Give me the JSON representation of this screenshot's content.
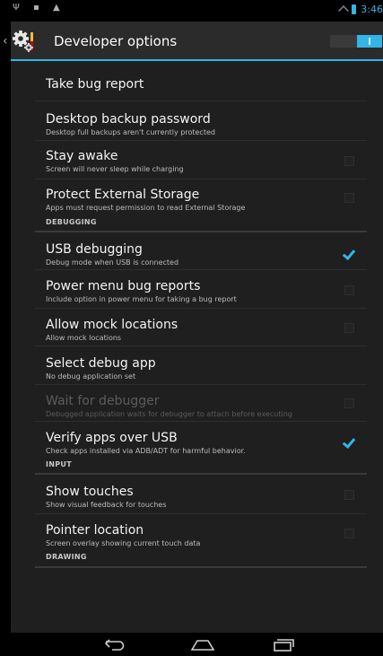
{
  "status_bar": {
    "left_icons": "Ψ ▪ ▲",
    "time": "3:46"
  },
  "action_bar": {
    "title": "Developer options",
    "up_indicator": "‹"
  },
  "toggle": {
    "state": "on"
  },
  "items": {
    "bug_report": {
      "title": "Take bug report"
    },
    "backup_password": {
      "title": "Desktop backup password",
      "summary": "Desktop full backups aren't currently protected"
    },
    "stay_awake": {
      "title": "Stay awake",
      "summary": "Screen will never sleep while charging",
      "checked": false
    },
    "protect_storage": {
      "title": "Protect External Storage",
      "summary": "Apps must request permission to read External Storage",
      "checked": false
    },
    "usb_debugging": {
      "title": "USB debugging",
      "summary": "Debug mode when USB is connected",
      "checked": true
    },
    "power_menu": {
      "title": "Power menu bug reports",
      "summary": "Include option in power menu for taking a bug report",
      "checked": false
    },
    "mock_locations": {
      "title": "Allow mock locations",
      "summary": "Allow mock locations",
      "checked": false
    },
    "debug_app": {
      "title": "Select debug app",
      "summary": "No debug application set"
    },
    "wait_debugger": {
      "title": "Wait for debugger",
      "summary": "Debugged application waits for debugger to attach before executing",
      "checked": false,
      "enabled": false
    },
    "verify_apps": {
      "title": "Verify apps over USB",
      "summary": "Check apps installed via ADB/ADT for harmful behavior.",
      "checked": true
    },
    "show_touches": {
      "title": "Show touches",
      "summary": "Show visual feedback for touches",
      "checked": false
    },
    "pointer_location": {
      "title": "Pointer location",
      "summary": "Screen overlay showing current touch data",
      "checked": false
    }
  },
  "categories": {
    "debugging": "DEBUGGING",
    "input": "INPUT",
    "drawing": "DRAWING"
  },
  "colors": {
    "accent": "#33b5e5",
    "background": "#1f1f1f"
  },
  "icons": {
    "app": "settings-gear-icon",
    "back": "back-icon",
    "home": "home-icon",
    "recent": "recent-apps-icon"
  }
}
